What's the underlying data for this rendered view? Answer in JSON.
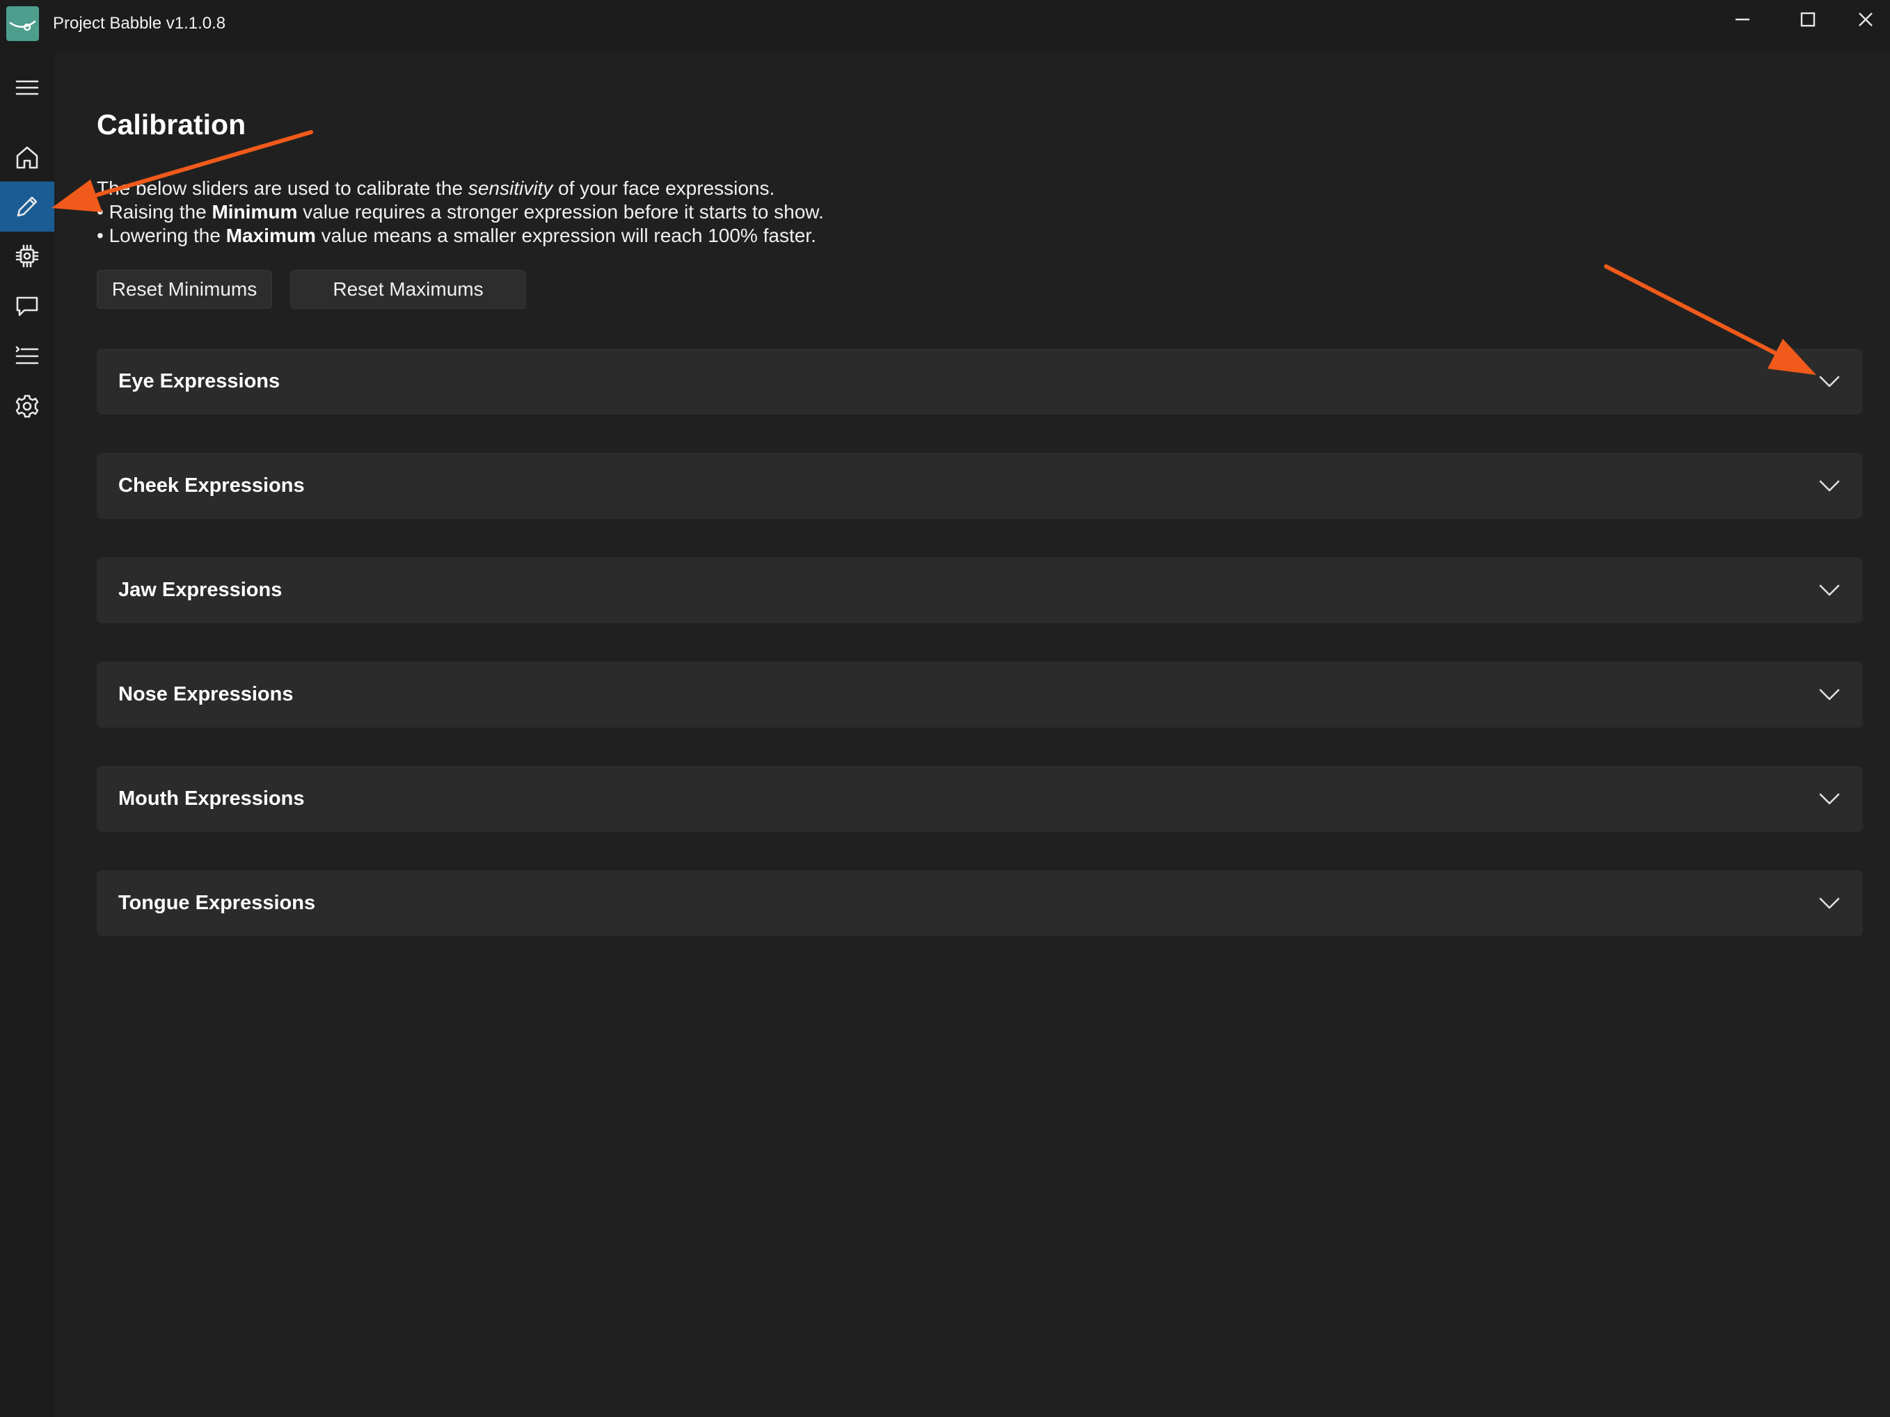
{
  "window": {
    "title": "Project Babble v1.1.0.8"
  },
  "titlebar_controls": {
    "minimize_icon": "minimize-icon",
    "maximize_icon": "maximize-icon",
    "close_icon": "close-icon"
  },
  "sidebar": {
    "items": [
      {
        "icon": "hamburger-menu-icon",
        "active": false
      },
      {
        "icon": "home-icon",
        "active": false
      },
      {
        "icon": "pencil-icon",
        "active": true
      },
      {
        "icon": "chip-icon",
        "active": false
      },
      {
        "icon": "chat-bubble-icon",
        "active": false
      },
      {
        "icon": "list-icon",
        "active": false
      },
      {
        "icon": "gear-icon",
        "active": false
      }
    ]
  },
  "page": {
    "title": "Calibration",
    "description": {
      "line1_prefix": "The below sliders are used to calibrate the ",
      "line1_emphasis": "sensitivity",
      "line1_suffix": " of your face expressions.",
      "line2_prefix": "• Raising the ",
      "line2_bold": "Minimum",
      "line2_suffix": " value requires a stronger expression before it starts to show.",
      "line3_prefix": "• Lowering the ",
      "line3_bold": "Maximum",
      "line3_suffix": " value means a smaller expression will reach 100% faster."
    },
    "buttons": {
      "reset_minimums": "Reset Minimums",
      "reset_maximums": "Reset Maximums"
    },
    "sections": [
      {
        "label": "Eye Expressions",
        "expanded": false
      },
      {
        "label": "Cheek Expressions",
        "expanded": false
      },
      {
        "label": "Jaw Expressions",
        "expanded": false
      },
      {
        "label": "Nose Expressions",
        "expanded": false
      },
      {
        "label": "Mouth Expressions",
        "expanded": false
      },
      {
        "label": "Tongue Expressions",
        "expanded": false
      }
    ]
  },
  "colors": {
    "background": "#1c1c1c",
    "content_background": "#202020",
    "section_background": "#2b2b2b",
    "active_nav": "#1a5d94",
    "app_icon": "#4d9e8d",
    "annotation_arrow": "#f05a1a"
  }
}
